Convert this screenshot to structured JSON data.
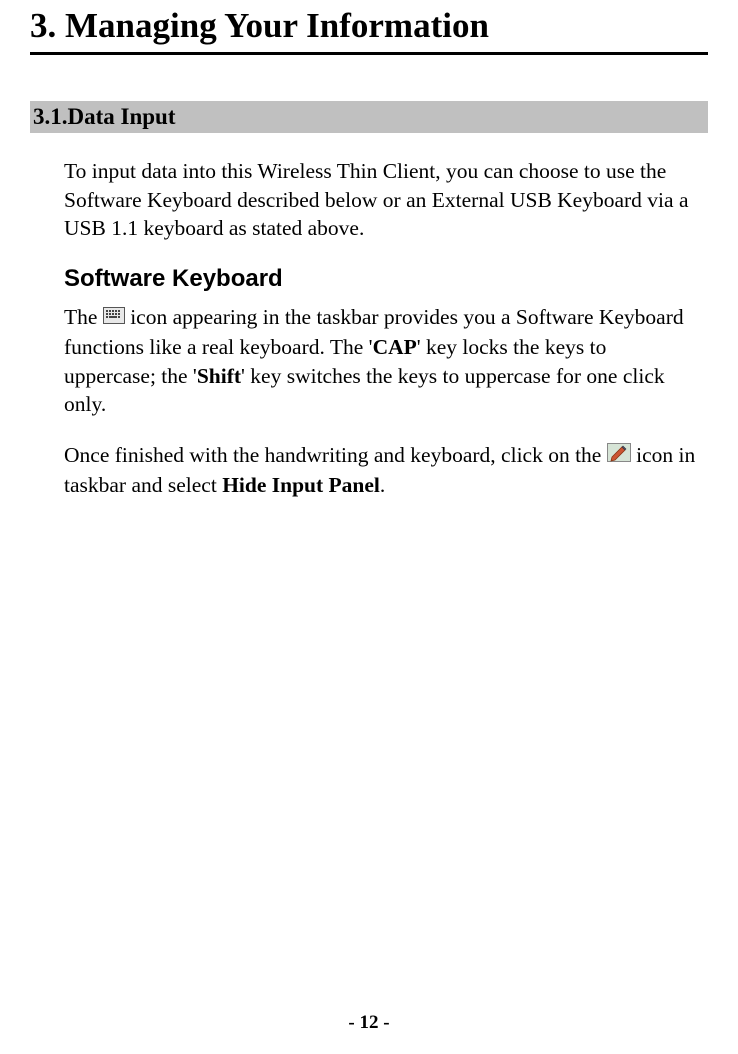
{
  "chapter": {
    "title": "3. Managing Your Information"
  },
  "section": {
    "heading": "3.1.Data Input",
    "intro_para": "To input data into this Wireless Thin Client, you can choose to use the Software Keyboard described below or an External USB Keyboard via a USB 1.1 keyboard as stated above.",
    "subheading": "Software Keyboard",
    "para2_a": "The ",
    "para2_b": " icon appearing in the taskbar provides you a Software Keyboard functions like a real keyboard. The '",
    "para2_cap": "CAP",
    "para2_c": "' key locks the keys to uppercase; the '",
    "para2_shift": "Shift",
    "para2_d": "' key switches the keys to uppercase for one click only.",
    "para3_a": "Once finished with the handwriting and keyboard, click on the ",
    "para3_b": " icon in taskbar and select ",
    "para3_hide": "Hide Input Panel",
    "para3_c": "."
  },
  "page_number": "- 12 -"
}
